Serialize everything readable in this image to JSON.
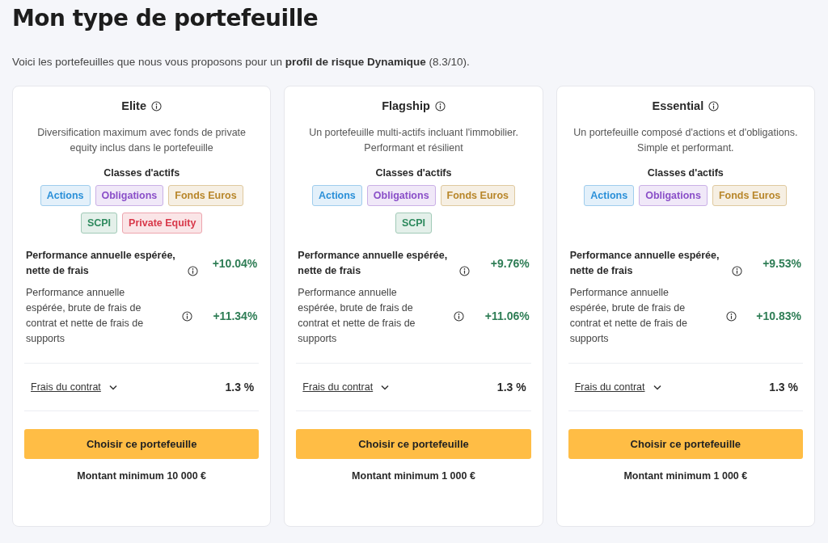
{
  "title": "Mon type de portefeuille",
  "intro": "Voici les portefeuilles que nous vous proposons pour un **profil de risque Dynamique** (8.3/10).",
  "portfolios": [
    {
      "name": "Elite",
      "description": "Diversification maximum avec fonds de private equity inclus dans le portefeuille",
      "classes_title": "Classes d'actifs",
      "tags": [
        {
          "label": "Actions",
          "color": "#2a8fd8"
        },
        {
          "label": "Obligations",
          "color": "#8a4fc8"
        },
        {
          "label": "Fonds Euros",
          "color": "#b8862a"
        },
        {
          "label": "SCPI",
          "color": "#2e8a5e"
        },
        {
          "label": "Private Equity",
          "color": "#d8384a"
        }
      ],
      "net_label": "Performance annuelle espérée, nette de frais",
      "net_value": "+10.04%",
      "gross_label": "Performance annuelle espérée, brute de frais de contrat et nette de frais de supports",
      "gross_value": "+11.34%",
      "fees_label": "Frais du contrat",
      "fees_value": "1.3 %",
      "expanded": false,
      "button": "Choisir ce portefeuille",
      "minimum": "Montant minimum 10 000 €"
    },
    {
      "name": "Flagship",
      "description": "Un portefeuille multi-actifs incluant l'immobilier. Performant et résilient",
      "classes_title": "Classes d'actifs",
      "tags": [
        {
          "label": "Actions",
          "color": "#2a8fd8"
        },
        {
          "label": "Obligations",
          "color": "#8a4fc8"
        },
        {
          "label": "Fonds Euros",
          "color": "#b8862a"
        },
        {
          "label": "SCPI",
          "color": "#2e8a5e"
        }
      ],
      "net_label": "Performance annuelle espérée, nette de frais",
      "net_value": "+9.76%",
      "gross_label": "Performance annuelle espérée, brute de frais de contrat et nette de frais de supports",
      "gross_value": "+11.06%",
      "fees_label": "Frais du contrat",
      "fees_value": "1.3 %",
      "expanded": false,
      "button": "Choisir ce portefeuille",
      "minimum": "Montant minimum 1 000 €"
    },
    {
      "name": "Essential",
      "description": "Un portefeuille composé d'actions et d'obligations. Simple et performant.",
      "classes_title": "Classes d'actifs",
      "tags": [
        {
          "label": "Actions",
          "color": "#2a8fd8"
        },
        {
          "label": "Obligations",
          "color": "#8a4fc8"
        },
        {
          "label": "Fonds Euros",
          "color": "#b8862a"
        }
      ],
      "net_label": "Performance annuelle espérée, nette de frais",
      "net_value": "+9.53%",
      "gross_label": "Performance annuelle espérée, brute de frais de contrat et nette de frais de supports",
      "gross_value": "+10.83%",
      "fees_label": "Frais du contrat",
      "fees_value": "1.3 %",
      "expanded": false,
      "button": "Choisir ce portefeuille",
      "minimum": "Montant minimum 1 000 €"
    }
  ]
}
